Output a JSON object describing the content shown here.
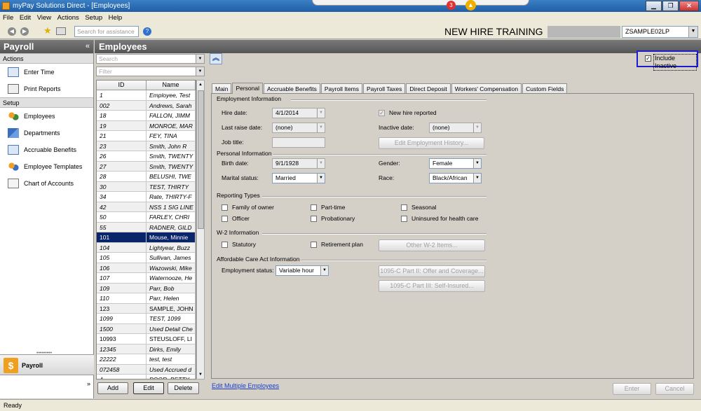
{
  "window": {
    "title": "mySolutions Direct - [Employees]",
    "title_display": "myPay Solutions Direct - [Employees]",
    "notification_count": "3"
  },
  "menu": [
    "File",
    "Edit",
    "View",
    "Actions",
    "Setup",
    "Help"
  ],
  "toolbar": {
    "search_placeholder": "Search for assistance",
    "company_title": "NEW HIRE TRAINING",
    "company_code": "ZSAMPLE02LP"
  },
  "nav": {
    "title": "Payroll",
    "actions_header": "Actions",
    "actions": [
      "Enter Time",
      "Print Reports"
    ],
    "setup_header": "Setup",
    "setup": [
      "Employees",
      "Departments",
      "Accruable Benefits",
      "Employee Templates",
      "Chart of Accounts"
    ],
    "bottom_label": "Payroll"
  },
  "main_title": "Employees",
  "list": {
    "search_placeholder": "Search",
    "filter_placeholder": "Filter",
    "col_id": "ID",
    "col_name": "Name",
    "rows": [
      {
        "id": "1",
        "name": "Employee, Test",
        "italic": true
      },
      {
        "id": "002",
        "name": "Andrews, Sarah",
        "italic": true
      },
      {
        "id": "18",
        "name": "FALLON, JIMM",
        "italic": true
      },
      {
        "id": "19",
        "name": "MONROE, MAR",
        "italic": true
      },
      {
        "id": "21",
        "name": "FEY, TINA",
        "italic": true
      },
      {
        "id": "23",
        "name": "Smith, John R",
        "italic": true
      },
      {
        "id": "26",
        "name": "Smith, TWENTY",
        "italic": true
      },
      {
        "id": "27",
        "name": "Smith, TWENTY",
        "italic": true
      },
      {
        "id": "28",
        "name": "BELUSHI, TWE",
        "italic": true
      },
      {
        "id": "30",
        "name": "TEST, THIRTY",
        "italic": true
      },
      {
        "id": "34",
        "name": "Rate, THIRTY-F",
        "italic": true
      },
      {
        "id": "42",
        "name": "NSS 1 SIG LINE",
        "italic": true
      },
      {
        "id": "50",
        "name": "FARLEY, CHRI",
        "italic": true
      },
      {
        "id": "55",
        "name": "RADNER, GILD",
        "italic": true
      },
      {
        "id": "101",
        "name": "Mouse, Minnie",
        "italic": false,
        "selected": true
      },
      {
        "id": "104",
        "name": "Lightyear, Buzz",
        "italic": true
      },
      {
        "id": "105",
        "name": "Sullivan, James",
        "italic": true
      },
      {
        "id": "106",
        "name": "Wazowski, Mike",
        "italic": true
      },
      {
        "id": "107",
        "name": "Waternooze, He",
        "italic": true
      },
      {
        "id": "109",
        "name": "Parr, Bob",
        "italic": true
      },
      {
        "id": "110",
        "name": "Parr, Helen",
        "italic": true
      },
      {
        "id": "123",
        "name": "SAMPLE, JOHN",
        "italic": false
      },
      {
        "id": "1099",
        "name": "TEST, 1099",
        "italic": true
      },
      {
        "id": "1500",
        "name": "Used Detail Che",
        "italic": true
      },
      {
        "id": "10993",
        "name": "STEUSLOFF, LI",
        "italic": false
      },
      {
        "id": "12345",
        "name": "Dirks, Emily",
        "italic": true
      },
      {
        "id": "22222",
        "name": "test, test",
        "italic": true
      },
      {
        "id": "072458",
        "name": "Used Accrued d",
        "italic": true
      },
      {
        "id": "A",
        "name": "POOR, BETTY",
        "italic": true
      }
    ],
    "add_label": "Add",
    "edit_label": "Edit",
    "delete_label": "Delete"
  },
  "include_inactive": {
    "label": "Include Inactive",
    "checked": true
  },
  "tabs": [
    "Main",
    "Personal",
    "Accruable Benefits",
    "Payroll Items",
    "Payroll Taxes",
    "Direct Deposit",
    "Workers' Compensation",
    "Custom Fields"
  ],
  "active_tab": "Personal",
  "employment": {
    "header": "Employment Information",
    "hire_date_label": "Hire date:",
    "hire_date": "4/1/2014",
    "new_hire_label": "New hire reported",
    "last_raise_label": "Last raise date:",
    "last_raise": "(none)",
    "inactive_label": "Inactive date:",
    "inactive": "(none)",
    "job_title_label": "Job title:",
    "job_title": "",
    "history_button": "Edit Employment History..."
  },
  "personal": {
    "header": "Personal Information",
    "birth_label": "Birth date:",
    "birth": "9/1/1928",
    "gender_label": "Gender:",
    "gender": "Female",
    "marital_label": "Marital status:",
    "marital": "Married",
    "race_label": "Race:",
    "race": "Black/African"
  },
  "reporting": {
    "header": "Reporting Types",
    "items": [
      "Family of owner",
      "Part-time",
      "Seasonal",
      "Officer",
      "Probationary",
      "Uninsured for health care"
    ]
  },
  "w2": {
    "header": "W-2 Information",
    "statutory": "Statutory",
    "retirement": "Retirement plan",
    "other_button": "Other W-2 Items..."
  },
  "aca": {
    "header": "Affordable Care Act Information",
    "status_label": "Employment status:",
    "status": "Variable hour",
    "part2_button": "1095-C Part II: Offer and Coverage...",
    "part3_button": "1095-C Part III: Self-Insured..."
  },
  "footer": {
    "edit_multiple": "Edit Multiple Employees",
    "enter": "Enter",
    "cancel": "Cancel"
  },
  "status": "Ready"
}
